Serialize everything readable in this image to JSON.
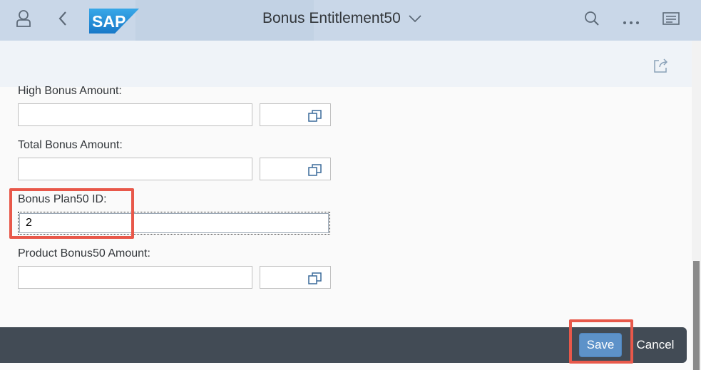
{
  "header": {
    "title": "Bonus Entitlement50",
    "logo_text": "SAP",
    "icons": [
      "user-icon",
      "back-icon",
      "search-icon",
      "overflow-icon",
      "menu-icon",
      "chevron-down-icon"
    ]
  },
  "form": {
    "fields": [
      {
        "label": "High Bonus Amount:",
        "value": "",
        "unit": ""
      },
      {
        "label": "Total Bonus Amount:",
        "value": "",
        "unit": ""
      },
      {
        "label": "Bonus Plan50 ID:",
        "value": "2"
      },
      {
        "label": "Product Bonus50 Amount:",
        "value": "",
        "unit": ""
      }
    ]
  },
  "footer": {
    "save_label": "Save",
    "cancel_label": "Cancel"
  },
  "colors": {
    "shell": "#c9d7e8",
    "save_button": "#5d92c9",
    "footer": "#424b55",
    "highlight": "#e8584a"
  }
}
